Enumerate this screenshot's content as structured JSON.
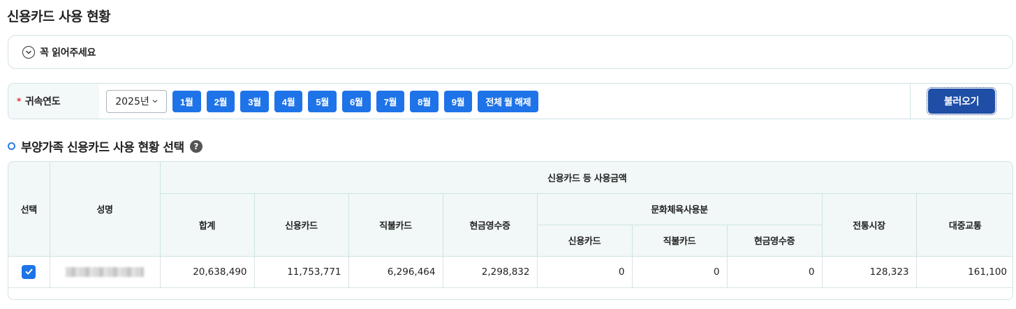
{
  "page": {
    "title": "신용카드 사용 현황"
  },
  "notice": {
    "label": "꼭 읽어주세요"
  },
  "filter": {
    "label": "귀속연도",
    "required_mark": "*",
    "year_value": "2025년",
    "months": [
      "1월",
      "2월",
      "3월",
      "4월",
      "5월",
      "6월",
      "7월",
      "8월",
      "9월"
    ],
    "clear_all_label": "전체 월 해제",
    "load_label": "불러오기"
  },
  "section": {
    "title": "부양가족 신용카드 사용 현황 선택",
    "help": "?"
  },
  "table": {
    "headers": {
      "select": "선택",
      "name": "성명",
      "group": "신용카드 등 사용금액",
      "total": "합계",
      "credit": "신용카드",
      "debit": "직불카드",
      "cash_receipt": "현금영수증",
      "culture_group": "문화체육사용분",
      "culture_credit": "신용카드",
      "culture_debit": "직불카드",
      "culture_cash": "현금영수증",
      "market": "전통시장",
      "transit": "대중교통"
    },
    "rows": [
      {
        "checked": true,
        "total": "20,638,490",
        "credit": "11,753,771",
        "debit": "6,296,464",
        "cash_receipt": "2,298,832",
        "culture_credit": "0",
        "culture_debit": "0",
        "culture_cash": "0",
        "market": "128,323",
        "transit": "161,100"
      }
    ]
  },
  "colors": {
    "accent": "#1f73e8",
    "load_button": "#1e4ea6",
    "border": "#cfe3e6",
    "header_bg": "#f1f8f7"
  }
}
